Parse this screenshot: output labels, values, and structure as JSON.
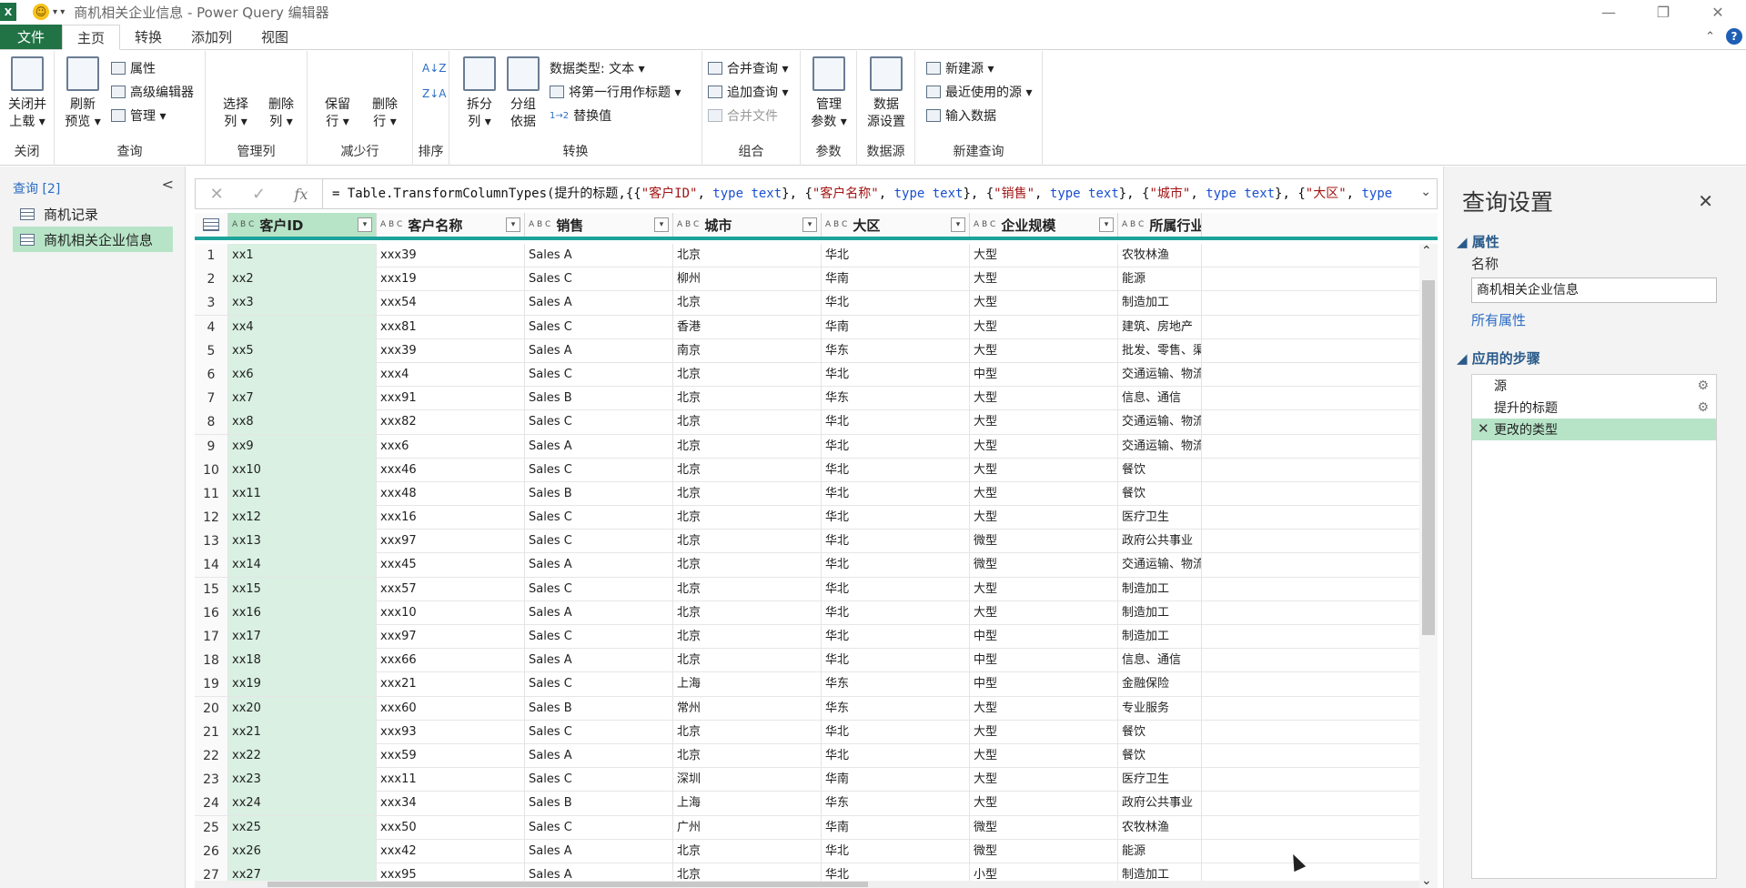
{
  "titlebar": {
    "logo": "X",
    "qat_smiley": "☺",
    "qat_more": "▾ ▾",
    "title": "商机相关企业信息 - Power Query 编辑器",
    "minimize": "—",
    "restore": "❐",
    "close": "✕"
  },
  "tabs": [
    {
      "label": "文件"
    },
    {
      "label": "主页"
    },
    {
      "label": "转换"
    },
    {
      "label": "添加列"
    },
    {
      "label": "视图"
    }
  ],
  "ribbon": {
    "close_group": {
      "label": "关闭",
      "close_load": "关闭并\n上载 ▾"
    },
    "query_group": {
      "label": "查询",
      "refresh": "刷新\n预览 ▾",
      "properties": "属性",
      "advanced_editor": "高级编辑器",
      "manage": "管理 ▾"
    },
    "manage_cols_group": {
      "label": "管理列",
      "choose_cols": "选择\n列 ▾",
      "remove_cols": "删除\n列 ▾"
    },
    "reduce_rows_group": {
      "label": "减少行",
      "keep_rows": "保留\n行 ▾",
      "remove_rows": "删除\n行 ▾"
    },
    "sort_group": {
      "label": "排序",
      "asc": "A↓Z",
      "desc": "Z↓A"
    },
    "transform_group": {
      "label": "转换",
      "split": "拆分\n列 ▾",
      "group_by": "分组\n依据",
      "data_type": "数据类型: 文本 ▾",
      "first_row_header": "将第一行用作标题 ▾",
      "replace_values": "替换值"
    },
    "combine_group": {
      "label": "组合",
      "merge": "合并查询 ▾",
      "append": "追加查询 ▾",
      "combine_files": "合并文件"
    },
    "params_group": {
      "label": "参数",
      "manage_params": "管理\n参数 ▾"
    },
    "datasource_group": {
      "label": "数据源",
      "ds_settings": "数据\n源设置"
    },
    "newquery_group": {
      "label": "新建查询",
      "new_source": "新建源 ▾",
      "recent": "最近使用的源 ▾",
      "enter_data": "输入数据"
    }
  },
  "left_pane": {
    "header": "查询 [2]",
    "collapse": "<",
    "items": [
      {
        "label": "商机记录"
      },
      {
        "label": "商机相关企业信息"
      }
    ]
  },
  "formula_bar": {
    "cancel": "✕",
    "confirm": "✓",
    "fx": "fx",
    "expand": "⌄",
    "parts": [
      {
        "t": "= Table.TransformColumnTypes(提升的标题,{{",
        "c": ""
      },
      {
        "t": "\"客户ID\"",
        "c": "str"
      },
      {
        "t": ", ",
        "c": ""
      },
      {
        "t": "type text",
        "c": "kw"
      },
      {
        "t": "}, {",
        "c": ""
      },
      {
        "t": "\"客户名称\"",
        "c": "str"
      },
      {
        "t": ", ",
        "c": ""
      },
      {
        "t": "type text",
        "c": "kw"
      },
      {
        "t": "}, {",
        "c": ""
      },
      {
        "t": "\"销售\"",
        "c": "str"
      },
      {
        "t": ", ",
        "c": ""
      },
      {
        "t": "type text",
        "c": "kw"
      },
      {
        "t": "}, {",
        "c": ""
      },
      {
        "t": "\"城市\"",
        "c": "str"
      },
      {
        "t": ", ",
        "c": ""
      },
      {
        "t": "type text",
        "c": "kw"
      },
      {
        "t": "}, {",
        "c": ""
      },
      {
        "t": "\"大区\"",
        "c": "str"
      },
      {
        "t": ", ",
        "c": ""
      },
      {
        "t": "type",
        "c": "kw"
      }
    ]
  },
  "grid": {
    "type_icon": "A B C",
    "columns": [
      "客户ID",
      "客户名称",
      "销售",
      "城市",
      "大区",
      "企业规模",
      "所属行业"
    ],
    "rows": [
      [
        "xx1",
        "xxx39",
        "Sales A",
        "北京",
        "华北",
        "大型",
        "农牧林渔"
      ],
      [
        "xx2",
        "xxx19",
        "Sales C",
        "柳州",
        "华南",
        "大型",
        "能源"
      ],
      [
        "xx3",
        "xxx54",
        "Sales A",
        "北京",
        "华北",
        "大型",
        "制造加工"
      ],
      [
        "xx4",
        "xxx81",
        "Sales C",
        "香港",
        "华南",
        "大型",
        "建筑、房地产"
      ],
      [
        "xx5",
        "xxx39",
        "Sales A",
        "南京",
        "华东",
        "大型",
        "批发、零售、渠道"
      ],
      [
        "xx6",
        "xxx4",
        "Sales C",
        "北京",
        "华北",
        "中型",
        "交通运输、物流"
      ],
      [
        "xx7",
        "xxx91",
        "Sales B",
        "北京",
        "华东",
        "大型",
        "信息、通信"
      ],
      [
        "xx8",
        "xxx82",
        "Sales C",
        "北京",
        "华北",
        "大型",
        "交通运输、物流"
      ],
      [
        "xx9",
        "xxx6",
        "Sales A",
        "北京",
        "华北",
        "大型",
        "交通运输、物流"
      ],
      [
        "xx10",
        "xxx46",
        "Sales C",
        "北京",
        "华北",
        "大型",
        "餐饮"
      ],
      [
        "xx11",
        "xxx48",
        "Sales B",
        "北京",
        "华北",
        "大型",
        "餐饮"
      ],
      [
        "xx12",
        "xxx16",
        "Sales C",
        "北京",
        "华北",
        "大型",
        "医疗卫生"
      ],
      [
        "xx13",
        "xxx97",
        "Sales C",
        "北京",
        "华北",
        "微型",
        "政府公共事业"
      ],
      [
        "xx14",
        "xxx45",
        "Sales A",
        "北京",
        "华北",
        "微型",
        "交通运输、物流"
      ],
      [
        "xx15",
        "xxx57",
        "Sales C",
        "北京",
        "华北",
        "大型",
        "制造加工"
      ],
      [
        "xx16",
        "xxx10",
        "Sales A",
        "北京",
        "华北",
        "大型",
        "制造加工"
      ],
      [
        "xx17",
        "xxx97",
        "Sales C",
        "北京",
        "华北",
        "中型",
        "制造加工"
      ],
      [
        "xx18",
        "xxx66",
        "Sales A",
        "北京",
        "华北",
        "中型",
        "信息、通信"
      ],
      [
        "xx19",
        "xxx21",
        "Sales C",
        "上海",
        "华东",
        "中型",
        "金融保险"
      ],
      [
        "xx20",
        "xxx60",
        "Sales B",
        "常州",
        "华东",
        "大型",
        "专业服务"
      ],
      [
        "xx21",
        "xxx93",
        "Sales C",
        "北京",
        "华北",
        "大型",
        "餐饮"
      ],
      [
        "xx22",
        "xxx59",
        "Sales A",
        "北京",
        "华北",
        "大型",
        "餐饮"
      ],
      [
        "xx23",
        "xxx11",
        "Sales C",
        "深圳",
        "华南",
        "大型",
        "医疗卫生"
      ],
      [
        "xx24",
        "xxx34",
        "Sales B",
        "上海",
        "华东",
        "大型",
        "政府公共事业"
      ],
      [
        "xx25",
        "xxx50",
        "Sales C",
        "广州",
        "华南",
        "微型",
        "农牧林渔"
      ],
      [
        "xx26",
        "xxx42",
        "Sales A",
        "北京",
        "华北",
        "微型",
        "能源"
      ],
      [
        "xx27",
        "xxx95",
        "Sales A",
        "北京",
        "华北",
        "小型",
        "制造加工"
      ]
    ]
  },
  "right_pane": {
    "title": "查询设置",
    "close": "✕",
    "properties_section": "◢ 属性",
    "name_label": "名称",
    "name_value": "商机相关企业信息",
    "all_properties": "所有属性",
    "steps_section": "◢ 应用的步骤",
    "steps": [
      {
        "label": "源",
        "gear": "⚙"
      },
      {
        "label": "提升的标题",
        "gear": "⚙"
      },
      {
        "label": "更改的类型",
        "mark": "✕"
      }
    ]
  }
}
